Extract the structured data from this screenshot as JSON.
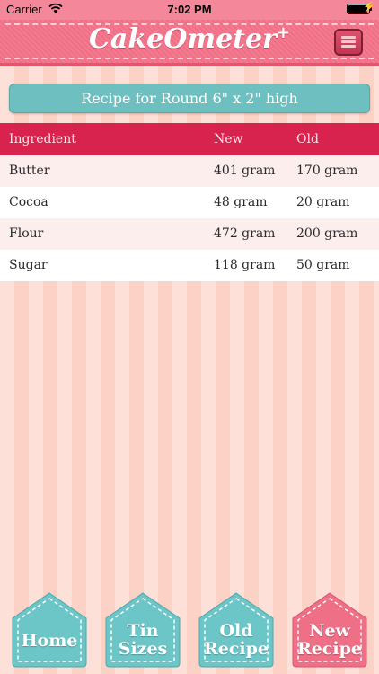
{
  "status": {
    "carrier": "Carrier",
    "time": "7:02 PM"
  },
  "header": {
    "title": "CakeOmeter",
    "title_sup": "+"
  },
  "recipe": {
    "title": "Recipe for Round 6\" x 2\" high"
  },
  "table": {
    "headers": [
      "Ingredient",
      "New",
      "Old"
    ],
    "rows": [
      [
        "Butter",
        "401 gram",
        "170 gram"
      ],
      [
        "Cocoa",
        "48 gram",
        "20 gram"
      ],
      [
        "Flour",
        "472 gram",
        "200 gram"
      ],
      [
        "Sugar",
        "118 gram",
        "50 gram"
      ]
    ]
  },
  "tabs": [
    {
      "line1": "Home",
      "line2": "",
      "color": "#6cc6c8"
    },
    {
      "line1": "Tin",
      "line2": "Sizes",
      "color": "#6cc6c8"
    },
    {
      "line1": "Old",
      "line2": "Recipe",
      "color": "#6cc6c8"
    },
    {
      "line1": "New",
      "line2": "Recipe",
      "color": "#ef6f86"
    }
  ],
  "colors": {
    "header": "#f06f86",
    "table_header": "#d8234e",
    "recipe_bar": "#6dbfc0"
  }
}
